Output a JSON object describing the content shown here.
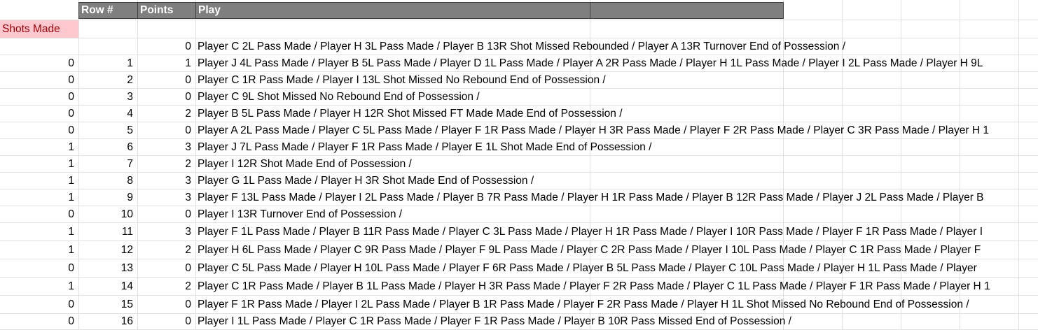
{
  "header": {
    "row_num": "Row #",
    "points": "Points",
    "play": "Play",
    "extra": ""
  },
  "label": {
    "shots_made": "Shots Made"
  },
  "rows": [
    {
      "shots": "",
      "row": "",
      "points": "0",
      "play": "Player C 2L Pass Made / Player H 3L Pass Made / Player B 13R Shot Missed  Rebounded / Player A 13R Turnover End of Possession /"
    },
    {
      "shots": "0",
      "row": "1",
      "points": "1",
      "play": "Player J 4L Pass Made / Player B 5L Pass Made / Player D 1L Pass Made / Player A 2R Pass Made / Player H 1L Pass Made / Player I 2L Pass Made / Player H 9L"
    },
    {
      "shots": "0",
      "row": "2",
      "points": "0",
      "play": "Player C 1R Pass Made / Player I 13L Shot Missed  No Rebound End of Possession /"
    },
    {
      "shots": "0",
      "row": "3",
      "points": "0",
      "play": "Player C 9L Shot Missed  No Rebound End of Possession /"
    },
    {
      "shots": "0",
      "row": "4",
      "points": "2",
      "play": "Player B 5L Pass Made / Player H 12R Shot Missed FT Made Made End of Possession /"
    },
    {
      "shots": "0",
      "row": "5",
      "points": "0",
      "play": "Player A 2L Pass Made / Player C 5L Pass Made / Player F 1R Pass Made / Player H 3R Pass Made / Player F 2R Pass Made / Player C 3R Pass Made / Player H 1"
    },
    {
      "shots": "1",
      "row": "6",
      "points": "3",
      "play": "Player J 7L Pass Made / Player F 1R Pass Made / Player E 1L Shot Made End of Possession /"
    },
    {
      "shots": "1",
      "row": "7",
      "points": "2",
      "play": "Player I 12R Shot Made  End of Possession /"
    },
    {
      "shots": "1",
      "row": "8",
      "points": "3",
      "play": "Player G 1L Pass Made / Player H 3R Shot Made End of Possession /"
    },
    {
      "shots": "1",
      "row": "9",
      "points": "3",
      "play": "Player F 13L Pass Made / Player I 2L Pass Made / Player B 7R Pass Made / Player H 1R Pass Made / Player B 12R Pass Made / Player J 2L Pass Made / Player B"
    },
    {
      "shots": "0",
      "row": "10",
      "points": "0",
      "play": "Player I 13R Turnover End of Possession /"
    },
    {
      "shots": "1",
      "row": "11",
      "points": "3",
      "play": "Player F 1L Pass Made / Player B 11R Pass Made / Player C 3L Pass Made / Player H 1R Pass Made / Player I 10R Pass Made / Player F 1R Pass Made / Player I"
    },
    {
      "shots": "1",
      "row": "12",
      "points": "2",
      "play": "Player H 6L Pass Made / Player C 9R Pass Made / Player F 9L Pass Made / Player C 2R Pass Made / Player I  10L Pass Made / Player C 1R Pass Made / Player F"
    },
    {
      "shots": "0",
      "row": "13",
      "points": "0",
      "play": "Player C 5L Pass Made / Player H  10L Pass Made / Player F 6R Pass Made / Player B 5L Pass Made / Player C  10L Pass Made / Player H 1L Pass Made / Player"
    },
    {
      "shots": "1",
      "row": "14",
      "points": "2",
      "play": "Player C 1R Pass Made / Player B 1L Pass Made / Player H 3R Pass Made / Player F 2R Pass Made / Player C 1L Pass Made / Player F 1R Pass Made / Player H 1"
    },
    {
      "shots": "0",
      "row": "15",
      "points": "0",
      "play": "Player F 1R Pass Made / Player I 2L Pass Made / Player B 1R Pass Made / Player F 2R Pass Made / Player H 1L Shot Missed No Rebound End of Possession /"
    },
    {
      "shots": "0",
      "row": "16",
      "points": "0",
      "play": "Player I 1L Pass Made / Player C 1R Pass Made / Player F 1R Pass Made / Player B 10R Pass Missed End of Possession /"
    }
  ]
}
